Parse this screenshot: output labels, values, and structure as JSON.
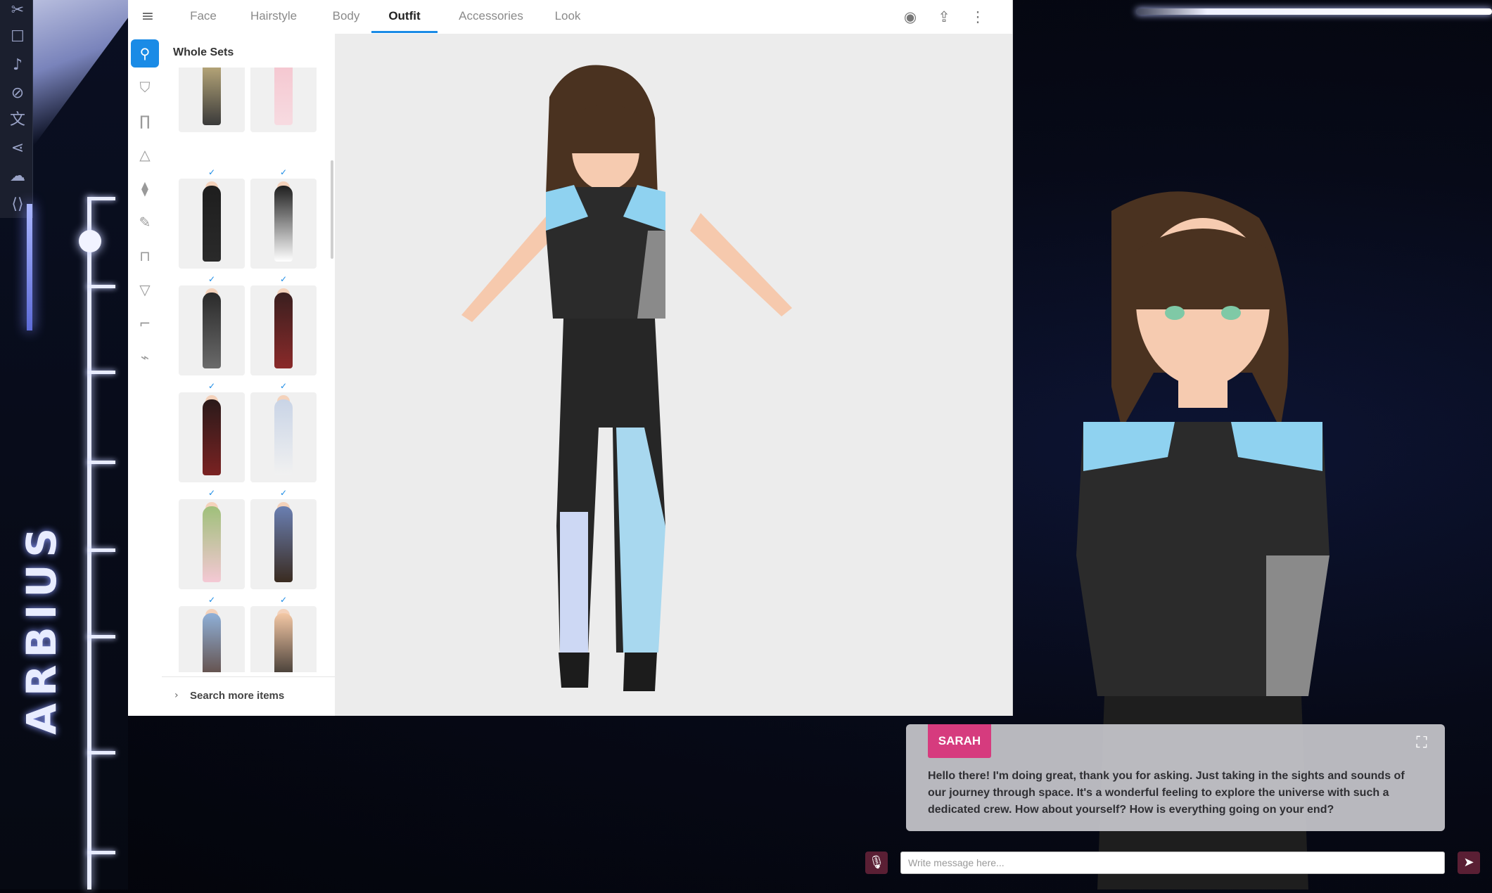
{
  "left_rail": {
    "icons": [
      "scissors-icon",
      "chat-icon",
      "speaker-icon",
      "camera-off-icon",
      "translate-icon",
      "share-icon",
      "download-icon",
      "code-icon"
    ],
    "brand_text": "ARBIUS"
  },
  "editor": {
    "tabs": [
      {
        "label": "Face",
        "active": false
      },
      {
        "label": "Hairstyle",
        "active": false
      },
      {
        "label": "Body",
        "active": false
      },
      {
        "label": "Outfit",
        "active": true
      },
      {
        "label": "Accessories",
        "active": false
      },
      {
        "label": "Look",
        "active": false
      }
    ],
    "tools": [
      "camera-icon",
      "export-icon",
      "more-vertical-icon"
    ],
    "categories": [
      "whole-set-icon",
      "top-icon",
      "bottom-icon",
      "dress-icon",
      "tie-icon",
      "brush-icon",
      "bag-icon",
      "underwear-icon",
      "shoe-icon",
      "accessory-icon"
    ],
    "panel_title": "Whole Sets",
    "search_more_label": "Search more items",
    "items": [
      {
        "colors": [
          "#d9c48a",
          "#3a3a3a"
        ]
      },
      {
        "colors": [
          "#f4c2cc",
          "#f7dbe1"
        ]
      },
      {
        "colors": [
          "#1e1e1e",
          "#2a2a2a"
        ]
      },
      {
        "colors": [
          "#1e1e1e",
          "#ffffff"
        ]
      },
      {
        "colors": [
          "#2a2a2a",
          "#6a6a6a"
        ]
      },
      {
        "colors": [
          "#3a1f1f",
          "#8a2a2a"
        ]
      },
      {
        "colors": [
          "#2a1a1a",
          "#7a2222"
        ]
      },
      {
        "colors": [
          "#c9d4e6",
          "#f1f1f1"
        ]
      },
      {
        "colors": [
          "#9fc07a",
          "#f4c8d4"
        ]
      },
      {
        "colors": [
          "#6a7fb2",
          "#3a2b20"
        ]
      },
      {
        "colors": [
          "#8fb0d8",
          "#5a3a2a"
        ]
      },
      {
        "colors": [
          "#f4c8a5",
          "#1e1e1e"
        ]
      }
    ]
  },
  "chat": {
    "speaker": "SARAH",
    "message": "Hello there! I'm doing great, thank you for asking. Just taking in the sights and sounds of our journey through space. It's a wonderful feeling to explore the universe with such a dedicated crew. How about yourself? How is everything going on your end?",
    "input_placeholder": "Write message here..."
  },
  "colors": {
    "accent": "#1a8be6",
    "speaker_badge": "#d63b7e",
    "send_button": "#5a1f34"
  }
}
